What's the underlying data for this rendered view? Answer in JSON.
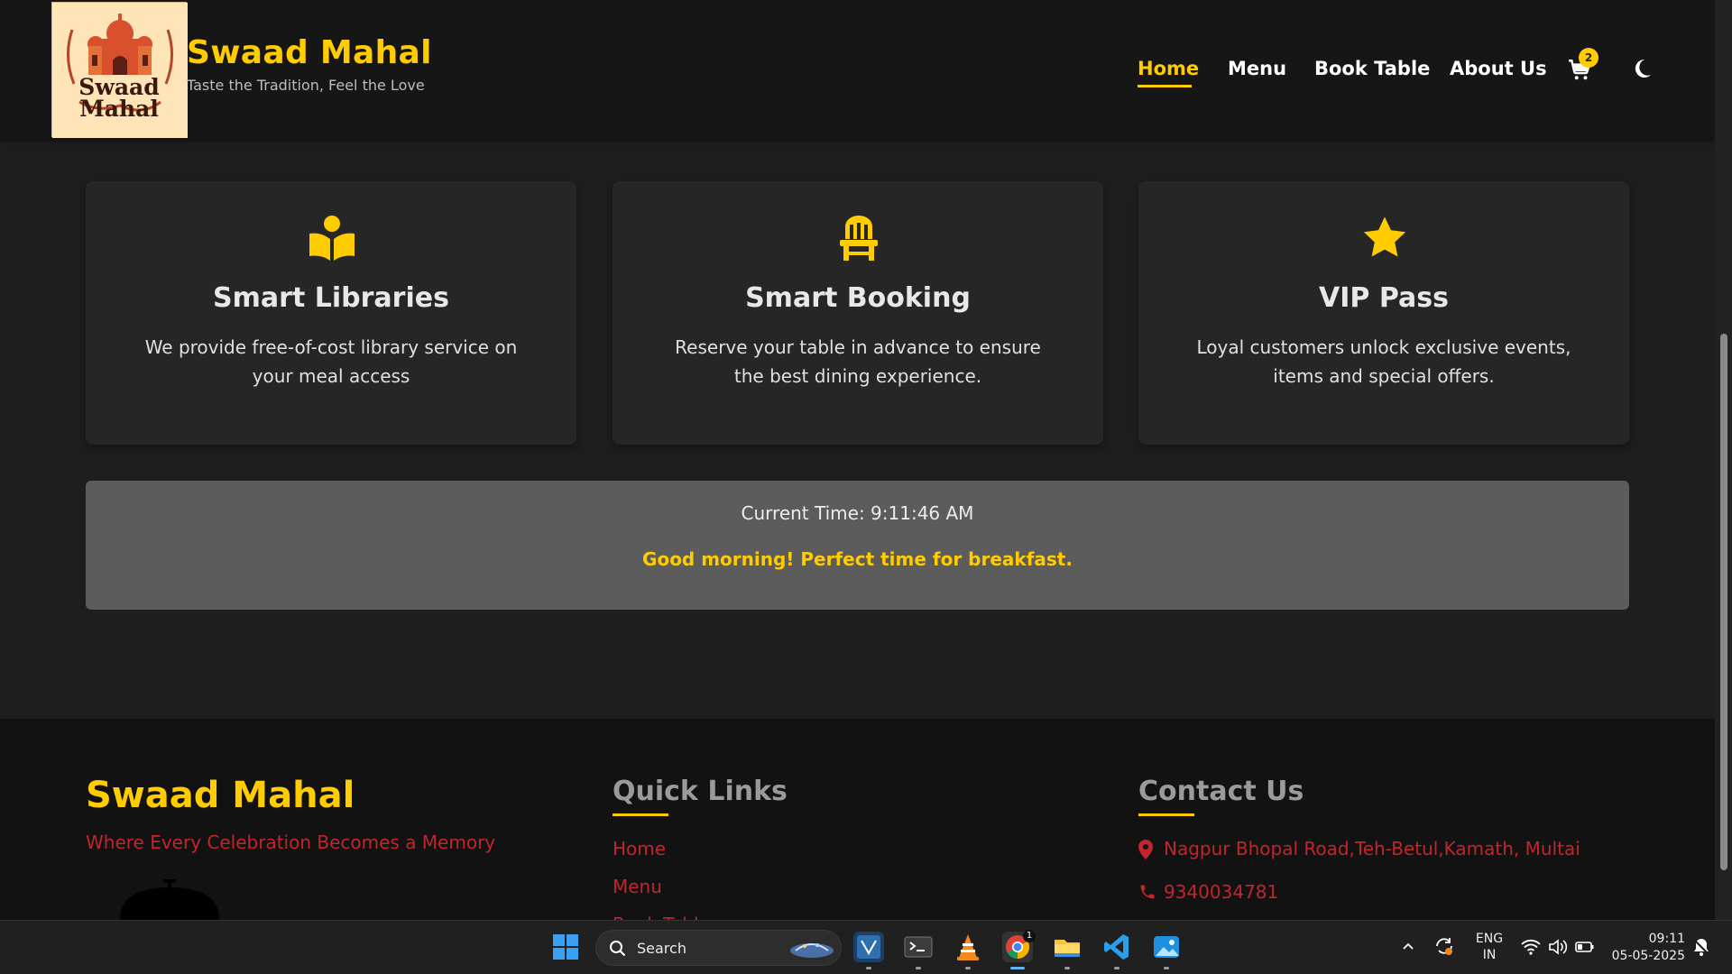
{
  "header": {
    "brand_title": "Swaad Mahal",
    "brand_subtitle": "Taste the Tradition, Feel the Love",
    "logo_text_line1": "Swaad",
    "logo_text_line2": "Mahal",
    "nav": [
      {
        "label": "Home",
        "active": true
      },
      {
        "label": "Menu"
      },
      {
        "label": "Book Table"
      },
      {
        "label": "About Us"
      }
    ],
    "cart_count": "2",
    "accent_color": "#ffcc00"
  },
  "features": [
    {
      "icon": "book-reader-icon",
      "title": "Smart Libraries",
      "text": "We provide free-of-cost library service on your meal access"
    },
    {
      "icon": "chair-icon",
      "title": "Smart Booking",
      "text": "Reserve your table in advance to ensure the best dining experience."
    },
    {
      "icon": "star-icon",
      "title": "VIP Pass",
      "text": "Loyal customers unlock exclusive events, items and special offers."
    }
  ],
  "time_panel": {
    "current_time": "Current Time: 9:11:46 AM",
    "greeting": "Good morning! Perfect time for breakfast."
  },
  "footer": {
    "brand": "Swaad Mahal",
    "tagline": "Where Every Celebration Becomes a Memory",
    "quick_links_title": "Quick Links",
    "quick_links": [
      "Home",
      "Menu",
      "Book Table"
    ],
    "contact_title": "Contact Us",
    "address": "Nagpur Bhopal Road,Teh-Betul,Kamath, Multai",
    "phone": "9340034781"
  },
  "taskbar": {
    "search_placeholder": "Search",
    "lang_line1": "ENG",
    "lang_line2": "IN",
    "clock_time": "09:11",
    "clock_date": "05-05-2025",
    "chrome_badge": "1"
  }
}
